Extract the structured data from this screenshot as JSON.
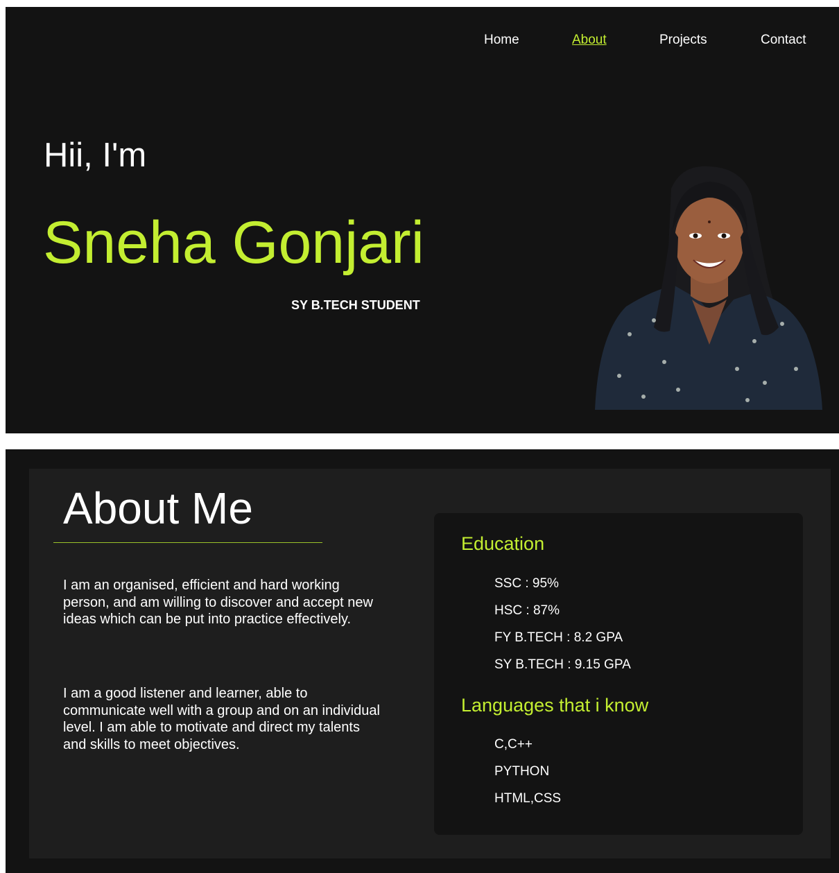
{
  "nav": {
    "items": [
      {
        "label": "Home"
      },
      {
        "label": "About"
      },
      {
        "label": "Projects"
      },
      {
        "label": "Contact"
      }
    ],
    "active": "About"
  },
  "hero": {
    "greeting": "Hii, I'm",
    "name": "Sneha Gonjari",
    "role": "SY B.TECH STUDENT",
    "portrait_alt": "portrait-photo"
  },
  "about": {
    "title": "About Me",
    "paragraphs": [
      "I am an organised, efficient and hard working person, and am willing to discover and accept new ideas which can be put into practice effectively.",
      "I am a good listener and learner, able to communicate well with a group and on an individual level. I am able to motivate and direct my talents and skills to meet objectives."
    ]
  },
  "education": {
    "heading": "Education",
    "items": [
      "SSC : 95%",
      "HSC : 87%",
      "FY B.TECH : 8.2 GPA",
      "SY B.TECH : 9.15 GPA"
    ]
  },
  "languages": {
    "heading": "Languages that i know",
    "items": [
      "C,C++",
      "PYTHON",
      "HTML,CSS"
    ]
  },
  "colors": {
    "background": "#131313",
    "panel": "#1e1e1e",
    "accent": "#c3ee31",
    "text": "#ffffff"
  }
}
